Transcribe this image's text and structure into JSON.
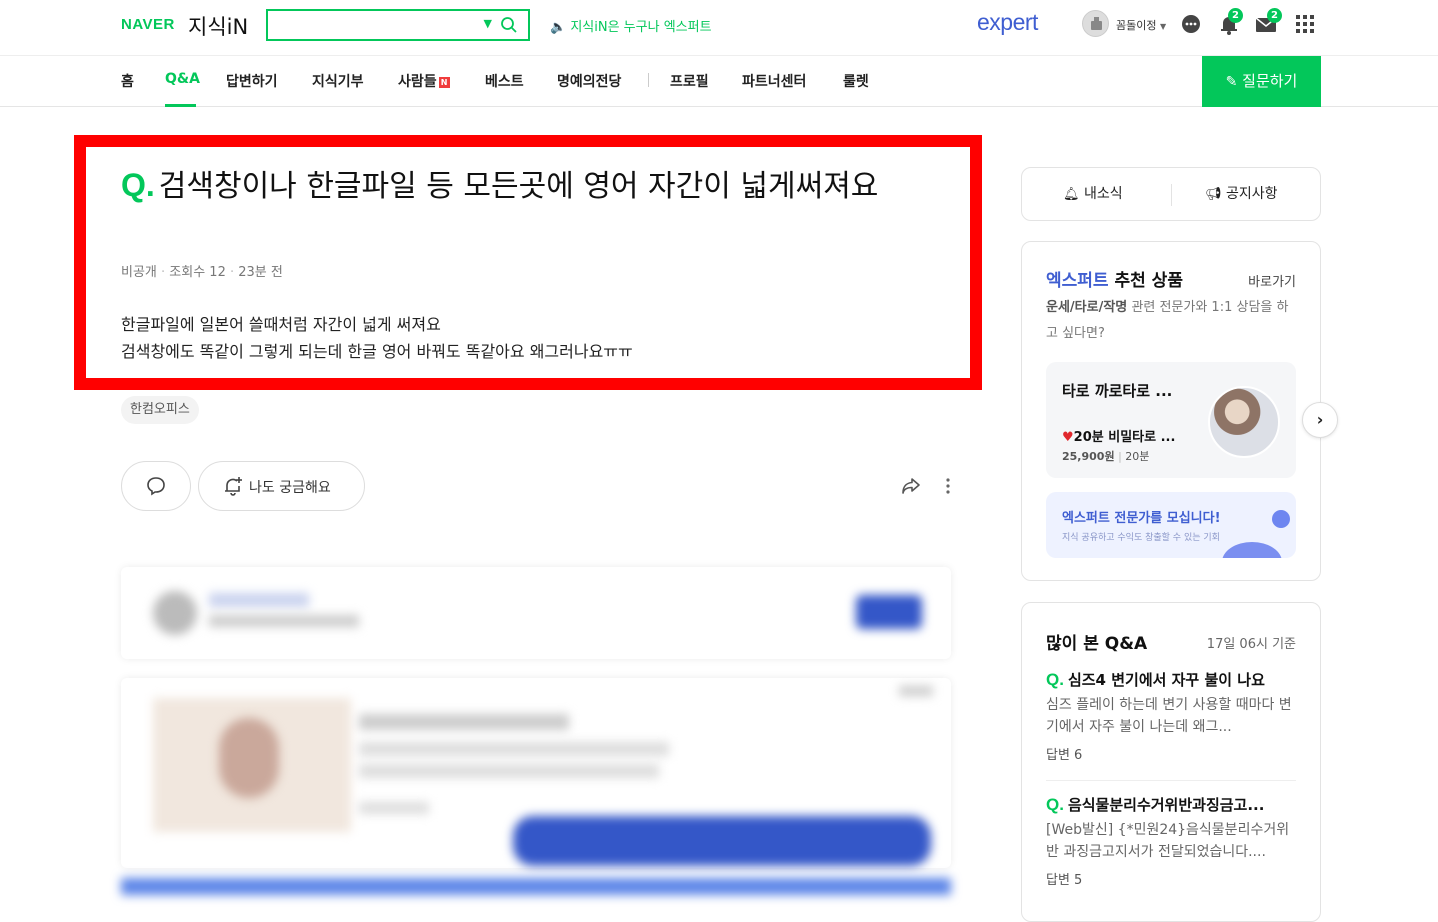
{
  "header": {
    "naver_logo": "NAVER",
    "service_logo": "지식iN",
    "search": {
      "value": "",
      "placeholder": ""
    },
    "notice": "지식iN은 누구나 엑스퍼트",
    "expert_logo": "expert",
    "username": "꼼돌이정",
    "notification_count": "2",
    "mail_count": "2"
  },
  "nav": {
    "items": [
      "홈",
      "Q&A",
      "답변하기",
      "지식기부",
      "사람들",
      "베스트",
      "명예의전당",
      "프로필",
      "파트너센터",
      "룰렛"
    ],
    "new_badge": "N",
    "active": "Q&A",
    "ask_button": "질문하기"
  },
  "question": {
    "q_mark": "Q.",
    "title": "검색창이나 한글파일 등 모든곳에 영어 자간이 넓게써져요",
    "author": "비공개",
    "views": "조회수 12",
    "time": "23분 전",
    "body_lines": [
      "한글파일에 일본어 쓸때처럼 자간이 넓게 써져요",
      "검색창에도 똑같이 그렇게 되는데 한글 영어 바꿔도 똑같아요 왜그러나요ㅠㅠ"
    ],
    "tag": "한컴오피스",
    "curious_button": "나도 궁금해요"
  },
  "sidebar": {
    "tabs": {
      "news": "내소식",
      "notice": "공지사항"
    },
    "expert": {
      "title_blue": "엑스퍼트",
      "title_rest": "추천 상품",
      "shortcut": "바로가기",
      "desc_bold": "운세/타로/작명",
      "desc_rest": "관련 전문가와 1:1 상담을 하고 싶다면?",
      "product": {
        "name": "타로 까로타로 ...",
        "subtitle": "20분 비밀타로 ...",
        "price": "25,900원",
        "duration": "20분"
      },
      "recruit_title": "엑스퍼트 전문가를 모십니다!",
      "recruit_sub": "지식 공유하고 수익도 창출할 수 있는 기회"
    },
    "popular": {
      "title": "많이 본 Q&A",
      "basis": "17일 06시 기준",
      "items": [
        {
          "q": "Q.",
          "title": "심즈4 변기에서 자꾸 불이 나요",
          "body": "심즈 플레이 하는데 변기 사용할 때마다 변기에서 자주 불이 나는데 왜그...",
          "answers": "답변 6"
        },
        {
          "q": "Q.",
          "title": "음식물분리수거위반과징금고...",
          "body": "[Web발신] {*민원24}음식물분리수거위반 과징금고지서가 전달되었습니다....",
          "answers": "답변 5"
        }
      ]
    }
  },
  "colors": {
    "naver_green": "#03c75a",
    "expert_blue": "#3f5ed1",
    "highlight_red": "#ff0000"
  }
}
